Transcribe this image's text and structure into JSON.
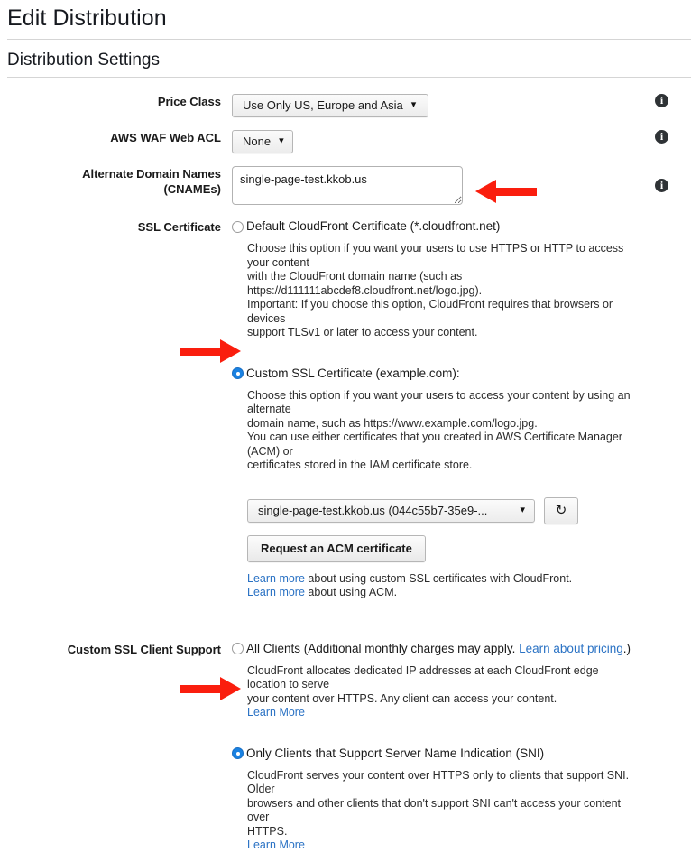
{
  "header": {
    "page_title": "Edit Distribution",
    "section_title": "Distribution Settings"
  },
  "icons": {
    "info": "i",
    "caret_down": "⌄",
    "refresh": "↻"
  },
  "fields": {
    "price_class": {
      "label": "Price Class",
      "value": "Use Only US, Europe and Asia"
    },
    "waf_acl": {
      "label": "AWS WAF Web ACL",
      "value": "None"
    },
    "cnames": {
      "label_line1": "Alternate Domain Names",
      "label_line2": "(CNAMEs)",
      "value": "single-page-test.kkob.us",
      "placeholder": ""
    },
    "ssl_certificate": {
      "label": "SSL Certificate",
      "default_option": {
        "label": "Default CloudFront Certificate (*.cloudfront.net)",
        "selected": false,
        "desc_line1": "Choose this option if you want your users to use HTTPS or HTTP to access your content",
        "desc_line2": "with the CloudFront domain name (such as",
        "desc_line3": "https://d111111abcdef8.cloudfront.net/logo.jpg).",
        "desc_line4": "Important: If you choose this option, CloudFront requires that browsers or devices",
        "desc_line5": "support TLSv1 or later to access your content."
      },
      "custom_option": {
        "label": "Custom SSL Certificate (example.com):",
        "selected": true,
        "desc_line1": "Choose this option if you want your users to access your content by using an alternate",
        "desc_line2": "domain name, such as https://www.example.com/logo.jpg.",
        "desc_line3": "You can use either certificates that you created in AWS Certificate Manager (ACM) or",
        "desc_line4": "certificates stored in the IAM certificate store.",
        "cert_select_value": "single-page-test.kkob.us (044c55b7-35e9-...",
        "request_button": "Request an ACM certificate",
        "learn_more_1_link": "Learn more",
        "learn_more_1_rest": " about using custom SSL certificates with CloudFront.",
        "learn_more_2_link": "Learn more",
        "learn_more_2_rest": " about using ACM."
      }
    },
    "client_support": {
      "label": "Custom SSL Client Support",
      "all_clients": {
        "selected": false,
        "text_before": "All Clients (Additional monthly charges may apply. ",
        "link": "Learn about pricing",
        "text_after": ".)",
        "desc_line1": "CloudFront allocates dedicated IP addresses at each CloudFront edge location to serve",
        "desc_line2": "your content over HTTPS. Any client can access your content.",
        "learn_more": "Learn More"
      },
      "sni": {
        "selected": true,
        "label": "Only Clients that Support Server Name Indication (SNI)",
        "desc_line1": "CloudFront serves your content over HTTPS only to clients that support SNI. Older",
        "desc_line2": "browsers and other clients that don't support SNI can't access your content over",
        "desc_line3": "HTTPS.",
        "learn_more": "Learn More"
      }
    }
  },
  "colors": {
    "arrow_red": "#fa1e0e",
    "link_blue": "#2a72c4",
    "radio_selected": "#1a82e2"
  }
}
